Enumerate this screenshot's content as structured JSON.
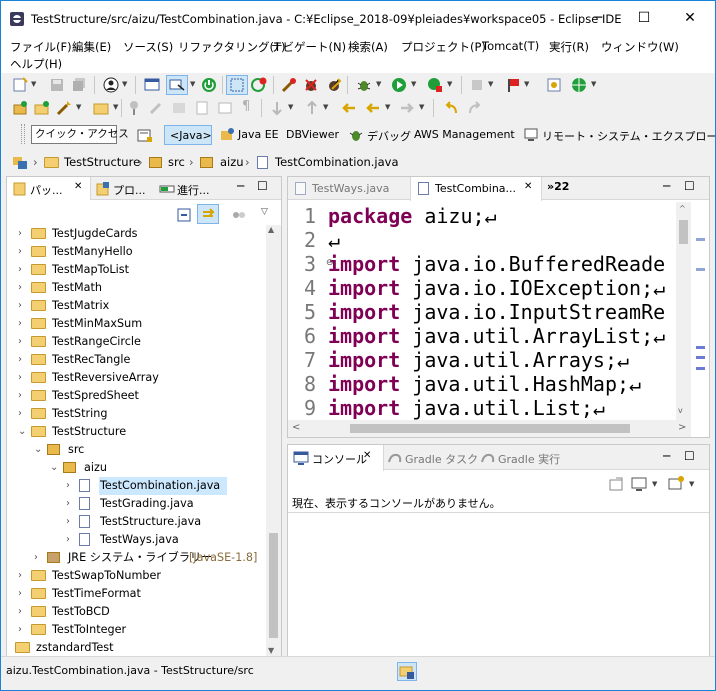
{
  "window": {
    "title": "TestStructure/src/aizu/TestCombination.java - C:¥Eclipse_2018-09¥pleiades¥workspace05 - Eclipse IDE",
    "minimize": "─",
    "maximize": "☐",
    "close": "✕"
  },
  "menu": [
    "ファイル(F)",
    "編集(E)",
    "ソース(S)",
    "リファクタリング(T)",
    "ナビゲート(N)",
    "検索(A)",
    "プロジェクト(P)",
    "Tomcat(T)",
    "実行(R)",
    "ウィンドウ(W)",
    "ヘルプ(H)"
  ],
  "quick_access": "クイック・アクセス",
  "perspectives": {
    "java": "<Java>",
    "java_ee": "Java EE",
    "dbviewer": "DBViewer",
    "debug": "デバッグ",
    "aws": "AWS Management",
    "remote": "リモート・システム・エクスプローラー"
  },
  "breadcrumb": [
    "TestStructure",
    "src",
    "aizu",
    "TestCombination.java"
  ],
  "left_tabs": {
    "package": "パッ...",
    "project": "プロ...",
    "progress": "進行..."
  },
  "tree": [
    {
      "label": "TestJugdeCards",
      "depth": 0,
      "kind": "project"
    },
    {
      "label": "TestManyHello",
      "depth": 0,
      "kind": "project"
    },
    {
      "label": "TestMapToList",
      "depth": 0,
      "kind": "project"
    },
    {
      "label": "TestMath",
      "depth": 0,
      "kind": "project"
    },
    {
      "label": "TestMatrix",
      "depth": 0,
      "kind": "project"
    },
    {
      "label": "TestMinMaxSum",
      "depth": 0,
      "kind": "project"
    },
    {
      "label": "TestRangeCircle",
      "depth": 0,
      "kind": "project"
    },
    {
      "label": "TestRecTangle",
      "depth": 0,
      "kind": "project"
    },
    {
      "label": "TestReversiveArray",
      "depth": 0,
      "kind": "project"
    },
    {
      "label": "TestSpredSheet",
      "depth": 0,
      "kind": "project"
    },
    {
      "label": "TestString",
      "depth": 0,
      "kind": "project"
    },
    {
      "label": "TestStructure",
      "depth": 0,
      "kind": "project",
      "open": true
    },
    {
      "label": "src",
      "depth": 1,
      "kind": "src",
      "open": true
    },
    {
      "label": "aizu",
      "depth": 2,
      "kind": "pkg",
      "open": true
    },
    {
      "label": "TestCombination.java",
      "depth": 3,
      "kind": "java",
      "selected": true
    },
    {
      "label": "TestGrading.java",
      "depth": 3,
      "kind": "java"
    },
    {
      "label": "TestStructure.java",
      "depth": 3,
      "kind": "java"
    },
    {
      "label": "TestWays.java",
      "depth": 3,
      "kind": "java"
    },
    {
      "label": "JRE システム・ライブラリー",
      "extra": "[JavaSE-1.8]",
      "depth": 1,
      "kind": "jre"
    },
    {
      "label": "TestSwapToNumber",
      "depth": 0,
      "kind": "project"
    },
    {
      "label": "TestTimeFormat",
      "depth": 0,
      "kind": "project"
    },
    {
      "label": "TestToBCD",
      "depth": 0,
      "kind": "project"
    },
    {
      "label": "TestToInteger",
      "depth": 0,
      "kind": "project"
    },
    {
      "label": "zstandardTest",
      "depth": -1,
      "kind": "project"
    }
  ],
  "editor": {
    "tabs": [
      "TestWays.java",
      "TestCombina...",
      "»22"
    ],
    "lines": [
      {
        "n": "1",
        "kw": "package",
        "rest": " aizu;↵"
      },
      {
        "n": "2",
        "kw": "",
        "rest": "↵"
      },
      {
        "n": "3",
        "kw": "import",
        "rest": " java.io.BufferedReade"
      },
      {
        "n": "4",
        "kw": "import",
        "rest": " java.io.IOException;↵"
      },
      {
        "n": "5",
        "kw": "import",
        "rest": " java.io.InputStreamRe"
      },
      {
        "n": "6",
        "kw": "import",
        "rest": " java.util.ArrayList;↵"
      },
      {
        "n": "7",
        "kw": "import",
        "rest": " java.util.Arrays;↵"
      },
      {
        "n": "8",
        "kw": "import",
        "rest": " java.util.HashMap;↵"
      },
      {
        "n": "9",
        "kw": "import",
        "rest": " java.util.List;↵"
      }
    ]
  },
  "console": {
    "tabs": [
      "コンソール",
      "Gradle タスク",
      "Gradle 実行"
    ],
    "message": "現在、表示するコンソールがありません。"
  },
  "status": "aizu.TestCombination.java - TestStructure/src",
  "colors": {
    "accent": "#0078d7",
    "keyword": "#7f0055",
    "selection": "#cce8ff"
  }
}
